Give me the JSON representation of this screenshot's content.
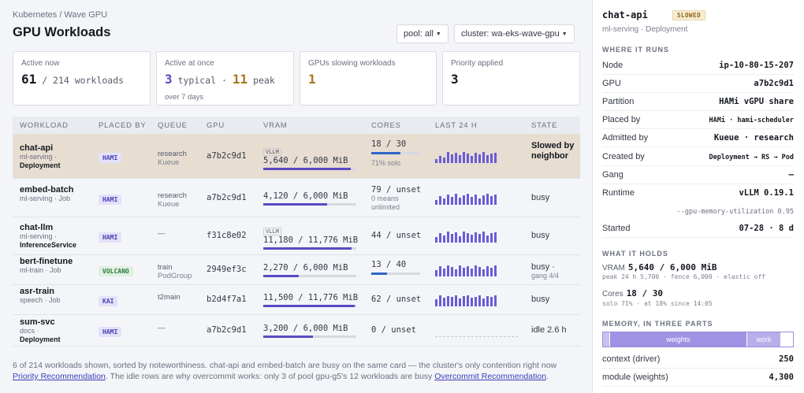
{
  "breadcrumb": "Kubernetes / Wave GPU",
  "page_title": "GPU Workloads",
  "filters": {
    "pool": "pool: all",
    "cluster": "cluster: wa-eks-wave-gpu"
  },
  "cards": {
    "active_now": {
      "label": "Active now",
      "value": "61",
      "rest": "/ 214 workloads"
    },
    "active_at_once": {
      "label": "Active at once",
      "typical": "3",
      "typical_label": "typical",
      "sep": "·",
      "peak": "11",
      "peak_label": "peak",
      "sub": "over 7 days"
    },
    "slowing": {
      "label": "GPUs slowing workloads",
      "value": "1"
    },
    "priority": {
      "label": "Priority applied",
      "value": "3"
    }
  },
  "columns": [
    "WORKLOAD",
    "PLACED BY",
    "QUEUE",
    "GPU",
    "VRAM",
    "CORES",
    "LAST 24 H",
    "STATE"
  ],
  "rows": [
    {
      "name": "chat-api",
      "meta1": "ml-serving ·",
      "meta2": "Deployment",
      "placed": "HAMI",
      "queue1": "research",
      "queue2": "Kueue",
      "gpu": "a7b2c9d1",
      "vtag": "VLLM",
      "vram": "5,640 / 6,000 MiB",
      "vram_frac": 0.94,
      "cores": "18 / 30",
      "cores_frac": 0.6,
      "cores_sub1": "71% solo",
      "cores_sub2": "",
      "spark": [
        5,
        9,
        7,
        14,
        11,
        13,
        10,
        14,
        12,
        9,
        13,
        11,
        14,
        10,
        12,
        13
      ],
      "state": "Slowed by neighbor",
      "state_sub": ""
    },
    {
      "name": "embed-batch",
      "meta1": "ml-serving · Job",
      "meta2": "",
      "placed": "HAMI",
      "queue1": "research",
      "queue2": "Kueue",
      "gpu": "a7b2c9d1",
      "vtag": "",
      "vram": "4,120 / 6,000 MiB",
      "vram_frac": 0.69,
      "cores": "79 / unset",
      "cores_frac": 0,
      "cores_sub1": "0 means",
      "cores_sub2": "unlimited",
      "spark": [
        6,
        11,
        8,
        13,
        10,
        14,
        9,
        12,
        14,
        10,
        13,
        8,
        12,
        14,
        11,
        13
      ],
      "state": "busy",
      "state_sub": ""
    },
    {
      "name": "chat-llm",
      "meta1": "ml-serving ·",
      "meta2": "InferenceService",
      "placed": "HAMI",
      "queue1": "—",
      "queue2": "",
      "gpu": "f31c8e02",
      "vtag": "VLLM",
      "vram": "11,180 / 11,776 MiB",
      "vram_frac": 0.95,
      "cores": "44 / unset",
      "cores_frac": 0,
      "cores_sub1": "",
      "cores_sub2": "",
      "spark": [
        7,
        12,
        9,
        14,
        11,
        13,
        8,
        14,
        12,
        10,
        13,
        11,
        14,
        9,
        12,
        13
      ],
      "state": "busy",
      "state_sub": ""
    },
    {
      "name": "bert-finetune",
      "meta1": "ml-train · Job",
      "meta2": "",
      "placed": "VOLCANO",
      "queue1": "train",
      "queue2": "PodGroup",
      "gpu": "2949ef3c",
      "vtag": "",
      "vram": "2,270 / 6,000 MiB",
      "vram_frac": 0.38,
      "cores": "13 / 40",
      "cores_frac": 0.33,
      "cores_sub1": "",
      "cores_sub2": "",
      "spark": [
        8,
        13,
        10,
        14,
        12,
        9,
        14,
        11,
        13,
        10,
        14,
        12,
        9,
        13,
        11,
        14
      ],
      "state": "busy ·",
      "state_sub": "gang 4/4"
    },
    {
      "name": "asr-train",
      "meta1": "speech · Job",
      "meta2": "",
      "placed": "KAI",
      "queue1": "t2main",
      "queue2": "",
      "gpu": "b2d4f7a1",
      "vtag": "",
      "vram": "11,500 / 11,776 MiB",
      "vram_frac": 0.98,
      "cores": "62 / unset",
      "cores_frac": 0,
      "cores_sub1": "",
      "cores_sub2": "",
      "spark": [
        9,
        14,
        11,
        13,
        12,
        14,
        10,
        13,
        14,
        11,
        12,
        14,
        10,
        13,
        12,
        14
      ],
      "state": "busy",
      "state_sub": ""
    },
    {
      "name": "sum-svc",
      "meta1": "docs ·",
      "meta2": "Deployment",
      "placed": "HAMI",
      "queue1": "—",
      "queue2": "",
      "gpu": "a7b2c9d1",
      "vtag": "",
      "vram": "3,200 / 6,000 MiB",
      "vram_frac": 0.53,
      "cores": "0 / unset",
      "cores_frac": 0,
      "cores_sub1": "",
      "cores_sub2": "",
      "spark": [],
      "state": "idle 2.6 h",
      "state_sub": ""
    }
  ],
  "footer": {
    "text1": "6 of 214 workloads shown, sorted by noteworthiness. chat-api and embed-batch are busy on the same card — the cluster's only contention right now",
    "link1": "Priority Recommendation",
    "text2": ". The idle rows are why overcommit works: only 3 of pool gpu-g5's 12 workloads are busy",
    "link2": "Overcommit Recommendation",
    "text3": "."
  },
  "side": {
    "title": "chat-api",
    "badge": "SLOWED",
    "subtitle": "ml-serving · Deployment",
    "sec_runs": "WHERE IT RUNS",
    "runs": [
      {
        "k": "Node",
        "v": "ip-10-80-15-207"
      },
      {
        "k": "GPU",
        "v": "a7b2c9d1"
      },
      {
        "k": "Partition",
        "v": "HAMi vGPU share"
      },
      {
        "k": "Placed by",
        "v": "HAMi · hami-scheduler"
      },
      {
        "k": "Admitted by",
        "v": "Kueue · research"
      },
      {
        "k": "Created by",
        "v": "Deployment → RS → Pod"
      },
      {
        "k": "Gang",
        "v": "—"
      },
      {
        "k": "Runtime",
        "v": "vLLM 0.19.1"
      }
    ],
    "runtime_extra": "--gpu-memory-utilization 0.95",
    "started": {
      "k": "Started",
      "v": "07-28 · 8 d"
    },
    "sec_holds": "WHAT IT HOLDS",
    "vram_label": "VRAM",
    "vram_value": "5,640 / 6,000 MiB",
    "vram_sub": "peak 24 h 5,700 · fence 6,000 · elastic off",
    "cores_label": "Cores",
    "cores_value": "18 / 30",
    "cores_sub": "solo 71% · at 18% since 14:05",
    "sec_memory": "MEMORY, IN THREE PARTS",
    "mem_weights": "weights",
    "mem_work": "work",
    "mem_rows": [
      {
        "k": "context (driver)",
        "v": "250"
      },
      {
        "k": "module (weights)",
        "v": "4,300"
      }
    ]
  },
  "colors": {
    "accent": "#5b49c4",
    "selected_row": "#e7ddd1",
    "cores_bar": "#2f64c8",
    "amber": "#a8741a"
  }
}
